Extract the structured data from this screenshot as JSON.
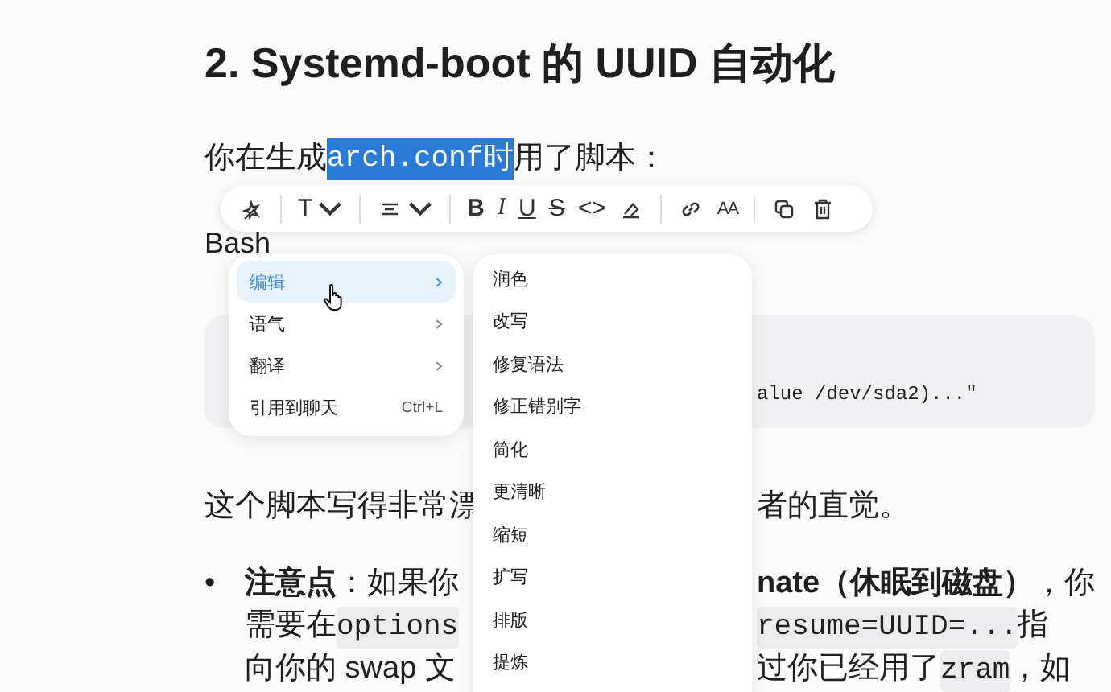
{
  "heading": "2. Systemd-boot 的 UUID 自动化",
  "intro": [
    {
      "kind": "plain",
      "text": "你在生成 ",
      "selected": false
    },
    {
      "kind": "code",
      "text": "arch.conf",
      "selected": true
    },
    {
      "kind": "plain",
      "text": " 时",
      "selected": true
    },
    {
      "kind": "plain",
      "text": "用了脚本：",
      "selected": false
    }
  ],
  "code_label": "Bash",
  "code_block": {
    "visible_text": "alue /dev/sda2)...\""
  },
  "paragraph": {
    "left": [
      {
        "kind": "plain",
        "text": "这个脚本写得非常漂"
      }
    ],
    "right": [
      {
        "kind": "plain",
        "text": "者的直觉。"
      }
    ]
  },
  "bullet": {
    "mark": "•",
    "lines": [
      {
        "left": [
          {
            "kind": "strong",
            "text": "注意点"
          },
          {
            "kind": "plain",
            "text": "：如果你"
          }
        ],
        "right": [
          {
            "kind": "strong",
            "text": "nate（休眠到磁盘）"
          },
          {
            "kind": "plain",
            "text": "，你"
          }
        ]
      },
      {
        "left": [
          {
            "kind": "plain",
            "text": "需要在 "
          },
          {
            "kind": "code",
            "text": "options"
          }
        ],
        "right": [
          {
            "kind": "code",
            "text": "resume=UUID=..."
          },
          {
            "kind": "plain",
            "text": " 指"
          }
        ]
      },
      {
        "left": [
          {
            "kind": "plain",
            "text": "向你的 swap 文"
          }
        ],
        "right": [
          {
            "kind": "plain",
            "text": "过你已经用了 "
          },
          {
            "kind": "code",
            "text": "zram"
          },
          {
            "kind": "plain",
            "text": "，如"
          }
        ]
      }
    ]
  },
  "toolbar": {
    "groups": [
      [
        {
          "kind": "icon",
          "dropdown": false
        }
      ],
      [
        {
          "kind": "letter",
          "label": "T",
          "dropdown": true
        }
      ],
      [
        {
          "kind": "icon",
          "dropdown": true
        }
      ],
      [
        {
          "kind": "letter",
          "label": "B",
          "dropdown": false
        },
        {
          "kind": "letter",
          "label": "I",
          "dropdown": false
        },
        {
          "kind": "letter",
          "label": "U",
          "dropdown": false
        },
        {
          "kind": "letter",
          "label": "S",
          "dropdown": false
        },
        {
          "kind": "letter",
          "label": "<>",
          "dropdown": false
        },
        {
          "kind": "icon",
          "dropdown": false
        }
      ],
      [
        {
          "kind": "icon",
          "dropdown": false
        },
        {
          "kind": "letter",
          "label": "AA",
          "dropdown": false
        }
      ],
      [
        {
          "kind": "icon",
          "dropdown": false
        },
        {
          "kind": "icon",
          "dropdown": false
        }
      ]
    ]
  },
  "context_menu": {
    "items": [
      {
        "label": "编辑",
        "selected": true,
        "submenu": true
      },
      {
        "label": "语气",
        "selected": false,
        "submenu": true
      },
      {
        "label": "翻译",
        "selected": false,
        "submenu": true
      },
      {
        "label": "引用到聊天",
        "selected": false,
        "submenu": false,
        "shortcut": "Ctrl+L"
      }
    ]
  },
  "submenu": {
    "items": [
      "润色",
      "改写",
      "修复语法",
      "修正错别字",
      "简化",
      "更清晰",
      "缩短",
      "扩写",
      "排版",
      "提炼"
    ]
  }
}
